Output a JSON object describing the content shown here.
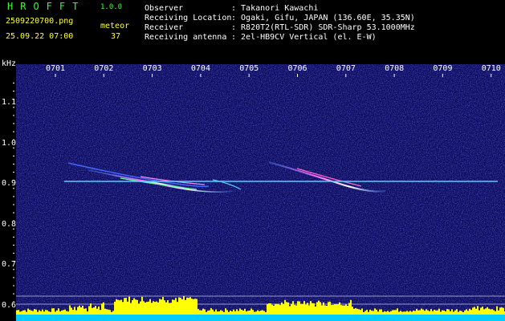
{
  "header": {
    "logo": "HROFFT",
    "version": "1.0.0",
    "filename": "2509220700.png",
    "mode": "meteor",
    "datetime": "25.09.22 07:00",
    "count": "37",
    "info": [
      {
        "label": "Observer",
        "value": ": Takanori Kawachi"
      },
      {
        "label": "Receiving Location",
        "value": ": Ogaki, Gifu, JAPAN (136.60E, 35.35N)"
      },
      {
        "label": "Receiver",
        "value": ": R820T2(RTL-SDR) SDR-Sharp 53.1000MHz"
      },
      {
        "label": "Receiving antenna",
        "value": ": 2el-HB9CV Vertical (el. E-W)"
      }
    ]
  },
  "spectrogram": {
    "y_unit": "kHz",
    "x_ticks": [
      "0701",
      "0702",
      "0703",
      "0704",
      "0705",
      "0706",
      "0707",
      "0708",
      "0709",
      "0710"
    ],
    "y_ticks": [
      "1.1",
      "1.0",
      "0.9",
      "0.8",
      "0.7",
      "0.6"
    ],
    "background_color": "#0a0a5a",
    "carrier_color": "#55ccff",
    "level_bar_color": "#ffff00",
    "baseline_color": "#00ccff"
  }
}
